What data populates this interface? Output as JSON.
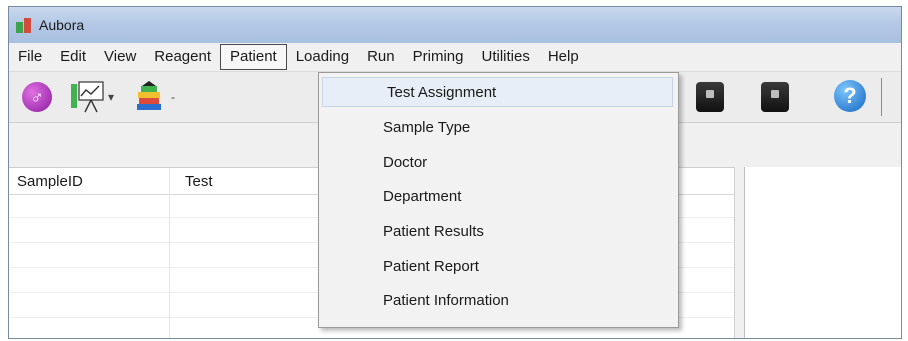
{
  "window": {
    "title": "Aubora"
  },
  "menubar": {
    "items": [
      {
        "label": "File"
      },
      {
        "label": "Edit"
      },
      {
        "label": "View"
      },
      {
        "label": "Reagent"
      },
      {
        "label": "Patient"
      },
      {
        "label": "Loading"
      },
      {
        "label": "Run"
      },
      {
        "label": "Priming"
      },
      {
        "label": "Utilities"
      },
      {
        "label": "Help"
      }
    ]
  },
  "toolbar": {
    "icons": [
      "user-icon",
      "chart-icon",
      "books-icon",
      "printer-icon",
      "printer-icon",
      "help-icon"
    ],
    "help_glyph": "?",
    "user_glyph": "♂"
  },
  "grid": {
    "columns": [
      "SampleID",
      "Test"
    ]
  },
  "patient_menu": {
    "items": [
      {
        "label": "Test Assignment"
      },
      {
        "label": "Sample Type"
      },
      {
        "label": "Doctor"
      },
      {
        "label": "Department"
      },
      {
        "label": "Patient Results"
      },
      {
        "label": "Patient Report"
      },
      {
        "label": "Patient Information"
      }
    ]
  }
}
